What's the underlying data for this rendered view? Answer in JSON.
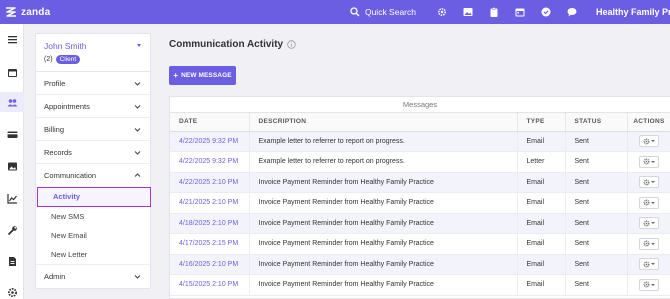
{
  "topbar": {
    "logo_text": "zanda",
    "quick_search_label": "Quick Search",
    "icons": [
      "gear-icon",
      "image-icon",
      "clipboard-icon",
      "calendar-icon",
      "check-circle-icon",
      "chat-icon"
    ],
    "practice_name": "Healthy Family Practice",
    "brand_color": "#6b5ee3"
  },
  "rail": {
    "items": [
      "menu-icon",
      "calendar-icon",
      "clients-icon",
      "billing-icon",
      "image-icon",
      "chart-icon",
      "wrench-icon",
      "document-icon",
      "settings-icon"
    ],
    "active": "clients-icon"
  },
  "client": {
    "name": "John Smith",
    "count": "(2)",
    "badge": "Client"
  },
  "sections": {
    "profile": "Profile",
    "appointments": "Appointments",
    "billing": "Billing",
    "records": "Records",
    "communication": "Communication",
    "admin": "Admin"
  },
  "communication_items": {
    "activity": "Activity",
    "new_sms": "New SMS",
    "new_email": "New Email",
    "new_letter": "New Letter"
  },
  "main": {
    "title": "Communication Activity",
    "new_message_label": "NEW MESSAGE",
    "table_caption": "Messages"
  },
  "table": {
    "headers": {
      "date": "DATE",
      "description": "DESCRIPTION",
      "type": "TYPE",
      "status": "STATUS",
      "actions": "ACTIONS"
    },
    "rows": [
      {
        "date": "4/22/2025 9:32 PM",
        "description": "Example letter to referrer to report on progress.",
        "type": "Email",
        "status": "Sent"
      },
      {
        "date": "4/22/2025 9:32 PM",
        "description": "Example letter to referrer to report on progress.",
        "type": "Letter",
        "status": "Sent"
      },
      {
        "date": "4/22/2025 2:10 PM",
        "description": "Invoice Payment Reminder from Healthy Family Practice",
        "type": "Email",
        "status": "Sent"
      },
      {
        "date": "4/21/2025 2:10 PM",
        "description": "Invoice Payment Reminder from Healthy Family Practice",
        "type": "Email",
        "status": "Sent"
      },
      {
        "date": "4/18/2025 2:10 PM",
        "description": "Invoice Payment Reminder from Healthy Family Practice",
        "type": "Email",
        "status": "Sent"
      },
      {
        "date": "4/17/2025 2:15 PM",
        "description": "Invoice Payment Reminder from Healthy Family Practice",
        "type": "Email",
        "status": "Sent"
      },
      {
        "date": "4/16/2025 2:10 PM",
        "description": "Invoice Payment Reminder from Healthy Family Practice",
        "type": "Email",
        "status": "Sent"
      },
      {
        "date": "4/15/2025 2:10 PM",
        "description": "Invoice Payment Reminder from Healthy Family Practice",
        "type": "Email",
        "status": "Sent"
      }
    ]
  }
}
